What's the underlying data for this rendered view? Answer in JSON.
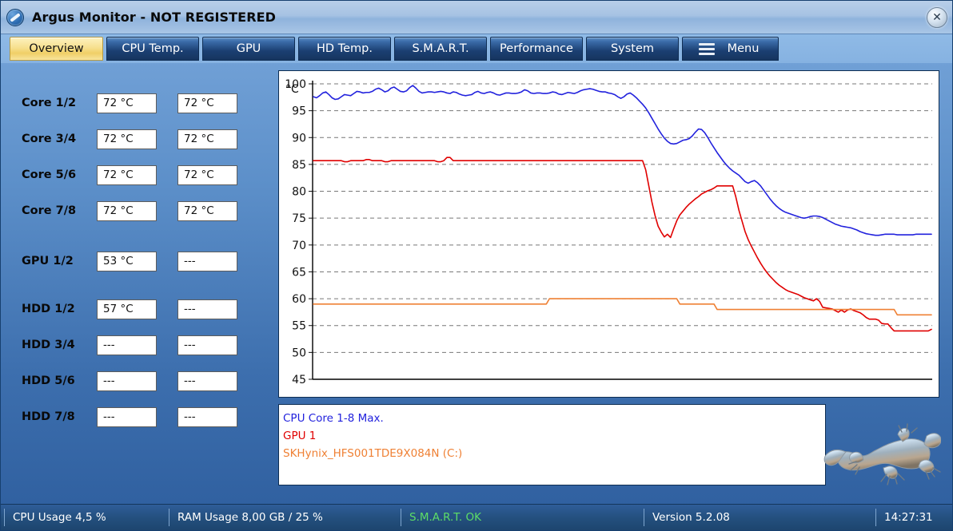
{
  "window": {
    "title": "Argus Monitor - NOT REGISTERED",
    "app_icon": "argus-disc-icon",
    "close_label": "✕"
  },
  "tabs": [
    {
      "label": "Overview",
      "active": true
    },
    {
      "label": "CPU Temp.",
      "active": false
    },
    {
      "label": "GPU",
      "active": false
    },
    {
      "label": "HD Temp.",
      "active": false
    },
    {
      "label": "S.M.A.R.T.",
      "active": false
    },
    {
      "label": "Performance",
      "active": false
    },
    {
      "label": "System",
      "active": false
    },
    {
      "label": "Menu",
      "active": false
    }
  ],
  "sensors": [
    {
      "label": "Core 1/2",
      "a": "72 °C",
      "b": "72 °C"
    },
    {
      "label": "Core 3/4",
      "a": "72 °C",
      "b": "72 °C"
    },
    {
      "label": "Core 5/6",
      "a": "72 °C",
      "b": "72 °C"
    },
    {
      "label": "Core 7/8",
      "a": "72 °C",
      "b": "72 °C"
    },
    {
      "label": "GPU 1/2",
      "a": "53 °C",
      "b": "---"
    },
    {
      "label": "HDD 1/2",
      "a": "57 °C",
      "b": "---"
    },
    {
      "label": "HDD 3/4",
      "a": "---",
      "b": "---"
    },
    {
      "label": "HDD 5/6",
      "a": "---",
      "b": "---"
    },
    {
      "label": "HDD 7/8",
      "a": "---",
      "b": "---"
    }
  ],
  "legend": [
    {
      "label": "CPU Core 1-8 Max.",
      "color": "#2222dd"
    },
    {
      "label": "GPU 1",
      "color": "#e00000"
    },
    {
      "label": "SKHynix_HFS001TDE9X084N (C:)",
      "color": "#ef8034"
    }
  ],
  "statusbar": {
    "cpu_usage": "CPU Usage 4,5 %",
    "ram_usage": "RAM Usage 8,00 GB / 25 %",
    "smart": "S.M.A.R.T. OK",
    "version": "Version 5.2.08",
    "time": "14:27:31"
  },
  "chart_data": {
    "type": "line",
    "title": "",
    "xlabel": "",
    "ylabel": "°C",
    "ylim": [
      45,
      100
    ],
    "yticks": [
      45,
      50,
      55,
      60,
      65,
      70,
      75,
      80,
      85,
      90,
      95,
      100
    ],
    "grid": true,
    "legend_position": "below-chart",
    "xlim": [
      0,
      200
    ],
    "series": [
      {
        "name": "CPU Core 1-8 Max.",
        "color": "#2222dd",
        "values": [
          97.6,
          97.4,
          97.8,
          98.3,
          98.5,
          98.0,
          97.4,
          97.1,
          97.2,
          97.6,
          98.0,
          97.9,
          97.8,
          98.2,
          98.6,
          98.5,
          98.3,
          98.4,
          98.4,
          98.6,
          99.0,
          99.2,
          98.9,
          98.5,
          98.7,
          99.2,
          99.4,
          99.0,
          98.6,
          98.5,
          98.7,
          99.3,
          99.7,
          99.2,
          98.6,
          98.3,
          98.4,
          98.5,
          98.5,
          98.4,
          98.5,
          98.6,
          98.5,
          98.3,
          98.2,
          98.5,
          98.4,
          98.1,
          97.9,
          97.8,
          97.9,
          98.0,
          98.4,
          98.6,
          98.3,
          98.2,
          98.4,
          98.5,
          98.3,
          98.0,
          97.9,
          98.1,
          98.3,
          98.3,
          98.2,
          98.2,
          98.3,
          98.5,
          98.9,
          98.7,
          98.3,
          98.2,
          98.3,
          98.3,
          98.2,
          98.2,
          98.3,
          98.5,
          98.4,
          98.1,
          98.0,
          98.2,
          98.4,
          98.3,
          98.2,
          98.4,
          98.7,
          98.9,
          99.0,
          99.1,
          99.0,
          98.8,
          98.6,
          98.5,
          98.5,
          98.3,
          98.2,
          98.0,
          97.6,
          97.3,
          97.6,
          98.1,
          98.3,
          97.9,
          97.4,
          96.8,
          96.2,
          95.5,
          94.6,
          93.6,
          92.6,
          91.6,
          90.7,
          89.9,
          89.3,
          88.9,
          88.8,
          88.9,
          89.2,
          89.5,
          89.6,
          89.8,
          90.3,
          91.0,
          91.6,
          91.5,
          90.9,
          90.0,
          89.0,
          88.1,
          87.2,
          86.4,
          85.6,
          84.9,
          84.3,
          83.8,
          83.4,
          83.0,
          82.4,
          81.8,
          81.5,
          81.8,
          82.0,
          81.6,
          81.0,
          80.2,
          79.4,
          78.6,
          77.9,
          77.3,
          76.8,
          76.4,
          76.1,
          75.9,
          75.7,
          75.5,
          75.3,
          75.1,
          75.0,
          75.1,
          75.3,
          75.4,
          75.4,
          75.3,
          75.1,
          74.8,
          74.5,
          74.2,
          73.9,
          73.7,
          73.5,
          73.4,
          73.3,
          73.2,
          73.0,
          72.8,
          72.5,
          72.3,
          72.1,
          72.0,
          71.9,
          71.8,
          71.8,
          71.9,
          72.0,
          72.0,
          72.0,
          72.0,
          71.9,
          71.9,
          71.9,
          71.9,
          71.9,
          71.9,
          72.0,
          72.0,
          72.0,
          72.0,
          72.0,
          72.0
        ]
      },
      {
        "name": "GPU 1",
        "color": "#e00000",
        "values": [
          85.7,
          85.7,
          85.7,
          85.7,
          85.7,
          85.7,
          85.7,
          85.7,
          85.7,
          85.7,
          85.5,
          85.5,
          85.7,
          85.7,
          85.7,
          85.7,
          85.7,
          85.9,
          85.9,
          85.7,
          85.7,
          85.7,
          85.7,
          85.5,
          85.5,
          85.7,
          85.7,
          85.7,
          85.7,
          85.7,
          85.7,
          85.7,
          85.7,
          85.7,
          85.7,
          85.7,
          85.7,
          85.7,
          85.7,
          85.7,
          85.5,
          85.5,
          85.7,
          86.3,
          86.3,
          85.7,
          85.7,
          85.7,
          85.7,
          85.7,
          85.7,
          85.7,
          85.7,
          85.7,
          85.7,
          85.7,
          85.7,
          85.7,
          85.7,
          85.7,
          85.7,
          85.7,
          85.7,
          85.7,
          85.7,
          85.7,
          85.7,
          85.7,
          85.7,
          85.7,
          85.7,
          85.7,
          85.7,
          85.7,
          85.7,
          85.7,
          85.7,
          85.7,
          85.7,
          85.7,
          85.7,
          85.7,
          85.7,
          85.7,
          85.7,
          85.7,
          85.7,
          85.7,
          85.7,
          85.7,
          85.7,
          85.7,
          85.7,
          85.7,
          85.7,
          85.7,
          85.7,
          85.7,
          85.7,
          85.7,
          85.7,
          85.7,
          85.7,
          85.7,
          85.7,
          85.7,
          85.7,
          84.0,
          81.0,
          78.0,
          75.5,
          73.5,
          72.4,
          71.5,
          72.0,
          71.4,
          73.0,
          74.5,
          75.6,
          76.3,
          77.0,
          77.6,
          78.1,
          78.6,
          79.0,
          79.5,
          79.8,
          80.1,
          80.3,
          80.6,
          81.0,
          81.0,
          81.0,
          81.0,
          81.0,
          81.0,
          79.0,
          76.5,
          74.5,
          72.5,
          71.0,
          69.8,
          68.7,
          67.6,
          66.6,
          65.7,
          64.9,
          64.2,
          63.6,
          63.0,
          62.5,
          62.1,
          61.7,
          61.4,
          61.2,
          61.0,
          60.8,
          60.5,
          60.2,
          60.0,
          59.8,
          59.6,
          60.0,
          59.5,
          58.4,
          58.3,
          58.2,
          58.1,
          57.8,
          57.5,
          57.9,
          57.5,
          57.9,
          58.1,
          57.8,
          57.6,
          57.4,
          57.0,
          56.5,
          56.2,
          56.2,
          56.2,
          56.0,
          55.4,
          55.3,
          55.3,
          54.6,
          54.0,
          54.0,
          54.0,
          54.0,
          54.0,
          54.0,
          54.0,
          54.0,
          54.0,
          54.0,
          54.0,
          54.0,
          54.3
        ]
      },
      {
        "name": "SKHynix_HFS001TDE9X084N (C:)",
        "color": "#ef8034",
        "values": [
          59.0,
          59.0,
          59.0,
          59.0,
          59.0,
          59.0,
          59.0,
          59.0,
          59.0,
          59.0,
          59.0,
          59.0,
          59.0,
          59.0,
          59.0,
          59.0,
          59.0,
          59.0,
          59.0,
          59.0,
          59.0,
          59.0,
          59.0,
          59.0,
          59.0,
          59.0,
          59.0,
          59.0,
          59.0,
          59.0,
          59.0,
          59.0,
          59.0,
          59.0,
          59.0,
          59.0,
          59.0,
          59.0,
          59.0,
          59.0,
          59.0,
          59.0,
          59.0,
          59.0,
          59.0,
          59.0,
          59.0,
          59.0,
          59.0,
          59.0,
          59.0,
          59.0,
          59.0,
          59.0,
          59.0,
          59.0,
          59.0,
          59.0,
          59.0,
          59.0,
          59.0,
          59.0,
          59.0,
          59.0,
          59.0,
          59.0,
          59.0,
          59.0,
          59.0,
          59.0,
          59.0,
          59.0,
          59.0,
          59.0,
          59.0,
          59.0,
          60.0,
          60.0,
          60.0,
          60.0,
          60.0,
          60.0,
          60.0,
          60.0,
          60.0,
          60.0,
          60.0,
          60.0,
          60.0,
          60.0,
          60.0,
          60.0,
          60.0,
          60.0,
          60.0,
          60.0,
          60.0,
          60.0,
          60.0,
          60.0,
          60.0,
          60.0,
          60.0,
          60.0,
          60.0,
          60.0,
          60.0,
          60.0,
          60.0,
          60.0,
          60.0,
          60.0,
          60.0,
          60.0,
          60.0,
          60.0,
          60.0,
          60.0,
          59.0,
          59.0,
          59.0,
          59.0,
          59.0,
          59.0,
          59.0,
          59.0,
          59.0,
          59.0,
          59.0,
          59.0,
          58.0,
          58.0,
          58.0,
          58.0,
          58.0,
          58.0,
          58.0,
          58.0,
          58.0,
          58.0,
          58.0,
          58.0,
          58.0,
          58.0,
          58.0,
          58.0,
          58.0,
          58.0,
          58.0,
          58.0,
          58.0,
          58.0,
          58.0,
          58.0,
          58.0,
          58.0,
          58.0,
          58.0,
          58.0,
          58.0,
          58.0,
          58.0,
          58.0,
          58.0,
          58.0,
          58.0,
          58.0,
          58.0,
          58.0,
          58.0,
          58.0,
          58.0,
          58.0,
          58.0,
          58.0,
          58.0,
          58.0,
          58.0,
          58.0,
          58.0,
          58.0,
          58.0,
          58.0,
          58.0,
          58.0,
          58.0,
          58.0,
          58.0,
          57.0,
          57.0,
          57.0,
          57.0,
          57.0,
          57.0,
          57.0,
          57.0,
          57.0,
          57.0,
          57.0,
          57.0
        ]
      }
    ]
  }
}
